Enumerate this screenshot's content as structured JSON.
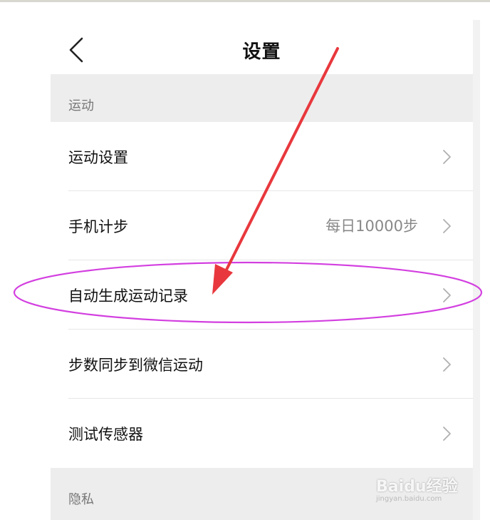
{
  "header": {
    "title": "设置",
    "back_icon": "chevron-left-icon"
  },
  "sections": [
    {
      "title": "运动",
      "items": [
        {
          "label": "运动设置",
          "value": ""
        },
        {
          "label": "手机计步",
          "value": "每日10000步"
        },
        {
          "label": "自动生成运动记录",
          "value": ""
        },
        {
          "label": "步数同步到微信运动",
          "value": ""
        },
        {
          "label": "测试传感器",
          "value": ""
        }
      ]
    },
    {
      "title": "隐私",
      "items": []
    }
  ],
  "annotation": {
    "arrow_color": "#e8383d",
    "ellipse_color": "#d33fe0"
  },
  "watermark": {
    "brand": "Bai",
    "paw": "du",
    "cn": "经验",
    "url": "jingyan.baidu.com"
  },
  "colors": {
    "section_bg": "#ededed",
    "divider": "#e6e6e6",
    "value_text": "#888888"
  }
}
